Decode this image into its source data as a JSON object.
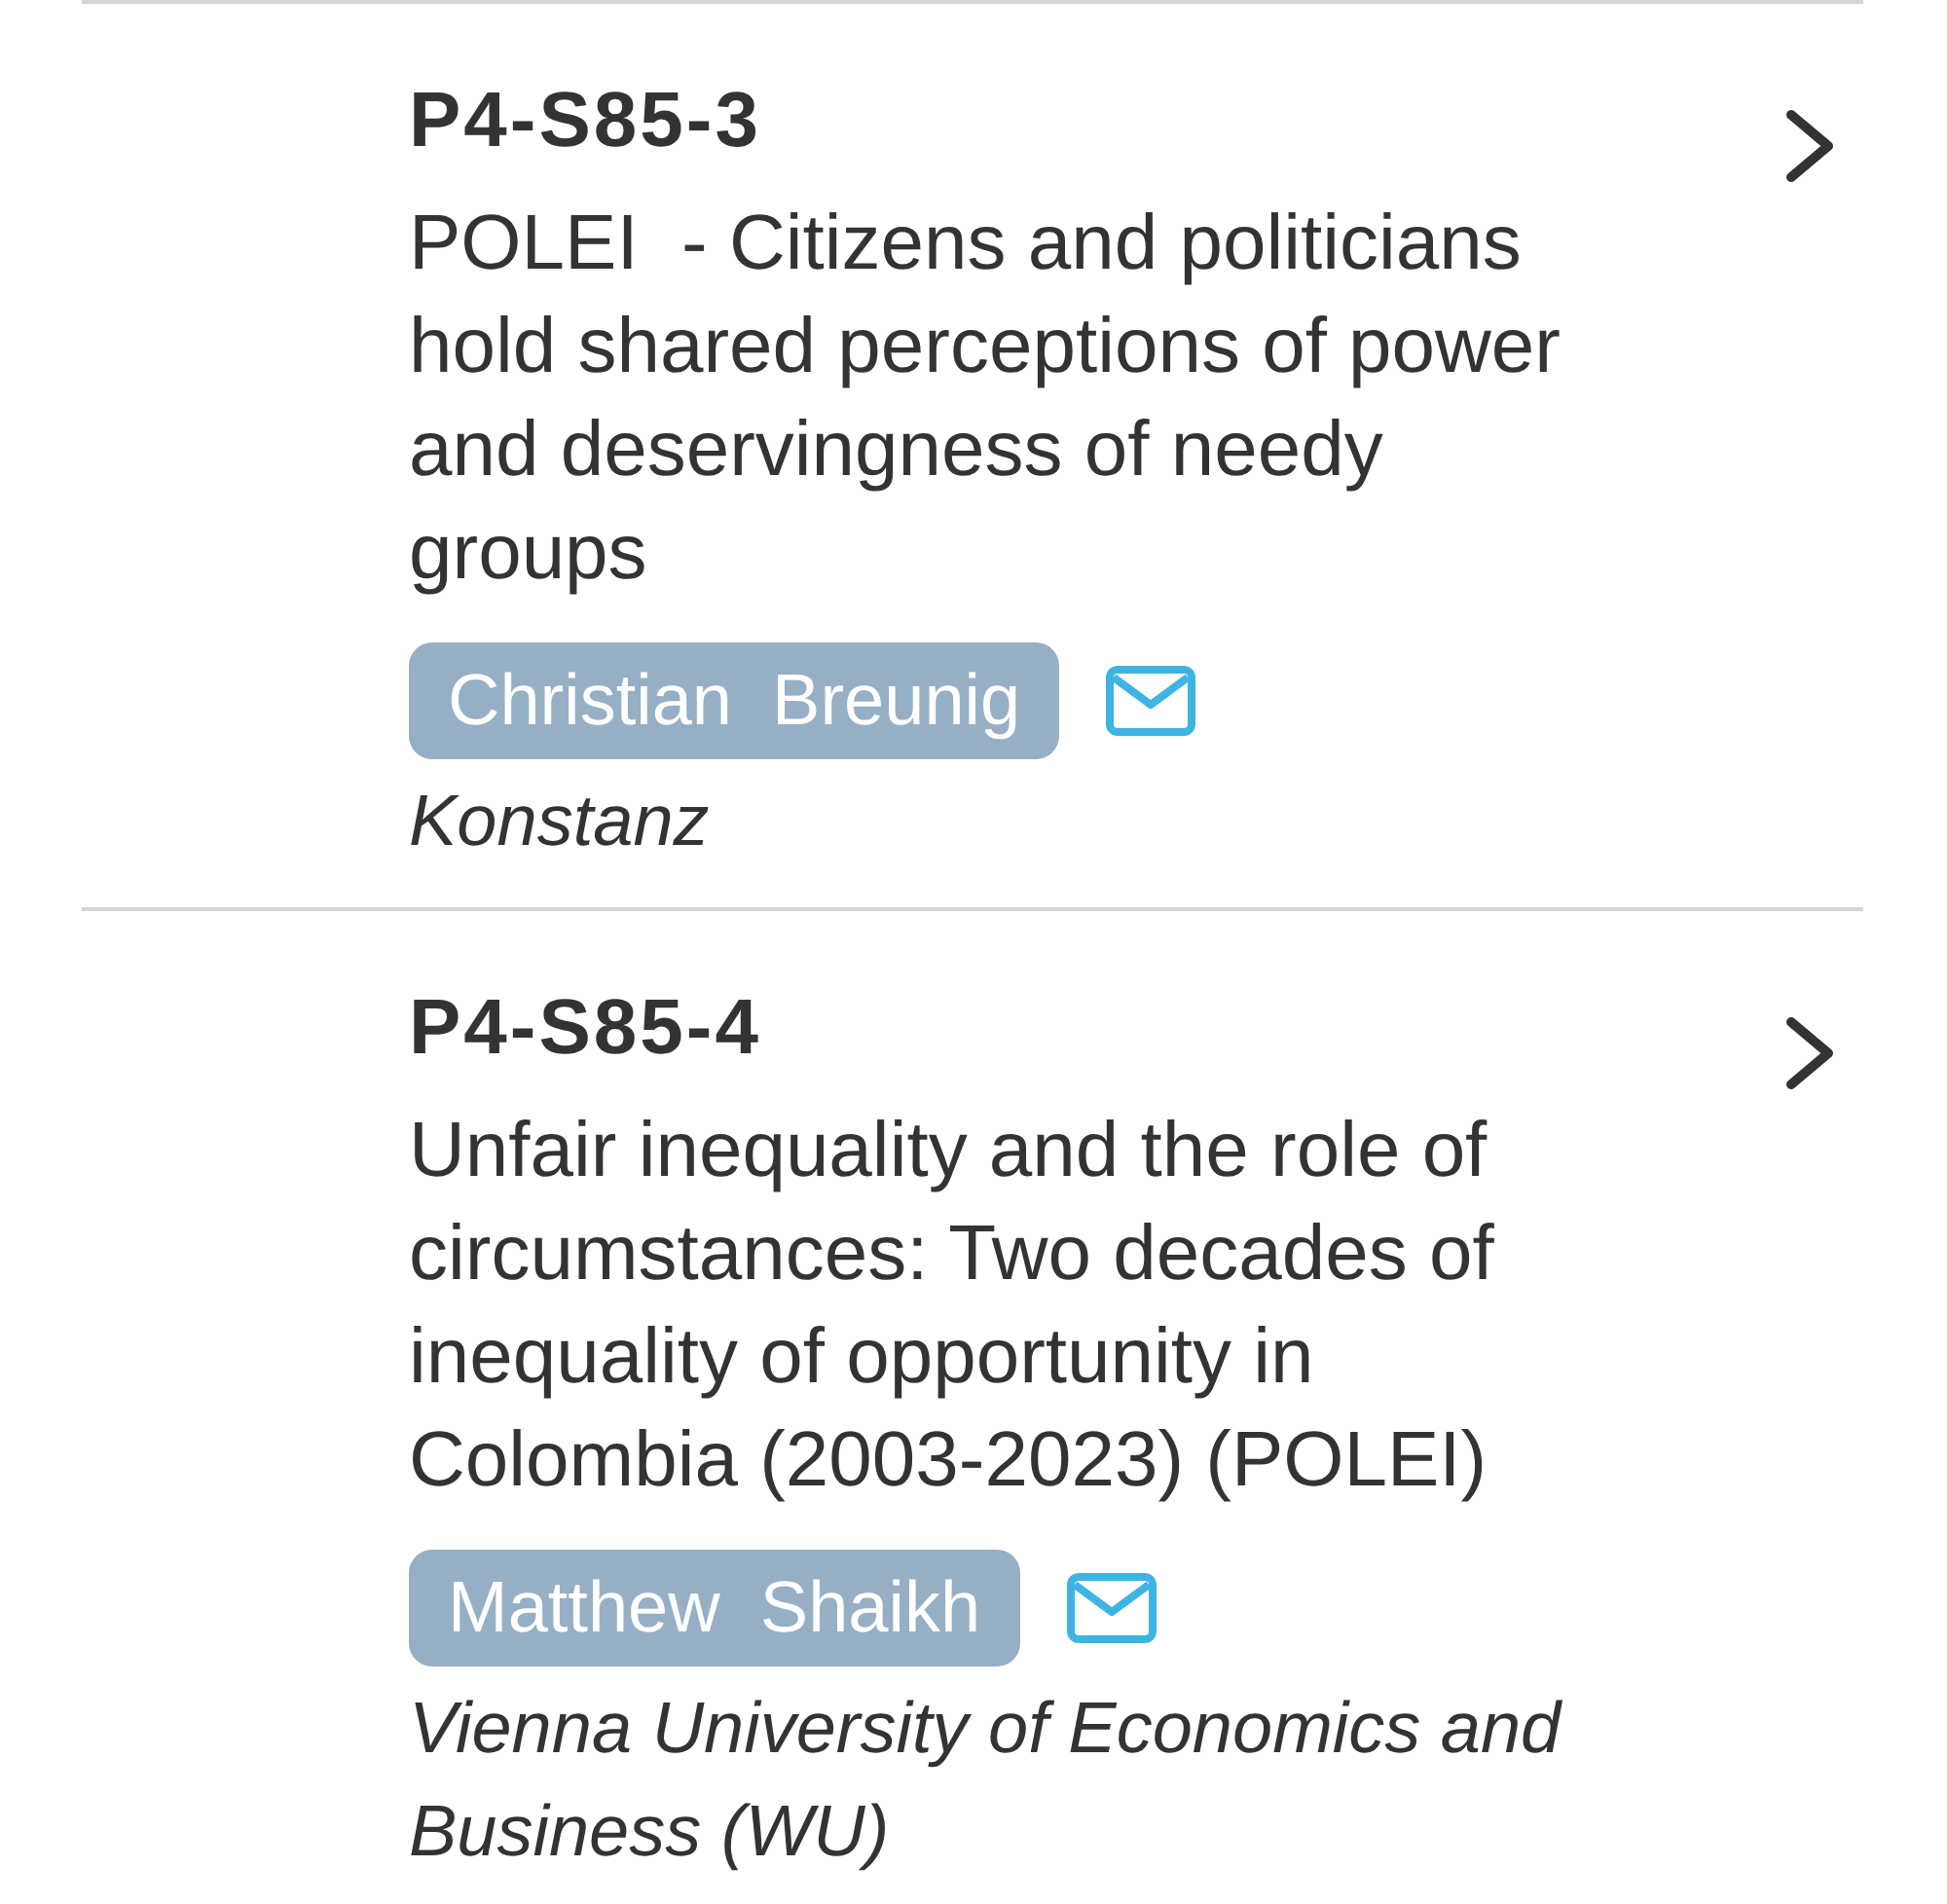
{
  "sessions": [
    {
      "code": "P4-S85-3",
      "title": "POLEI  - Citizens and politicians hold shared perceptions of power and deservingness of needy groups",
      "presenter": "Christian  Breunig",
      "affiliation": "Konstanz"
    },
    {
      "code": "P4-S85-4",
      "title": "Unfair inequality and the role of circumstances: Two decades of inequality of opportunity in Colombia (2003-2023) (POLEI)",
      "presenter": "Matthew  Shaikh",
      "affiliation": "Vienna University of Economics and Business (WU)"
    }
  ]
}
